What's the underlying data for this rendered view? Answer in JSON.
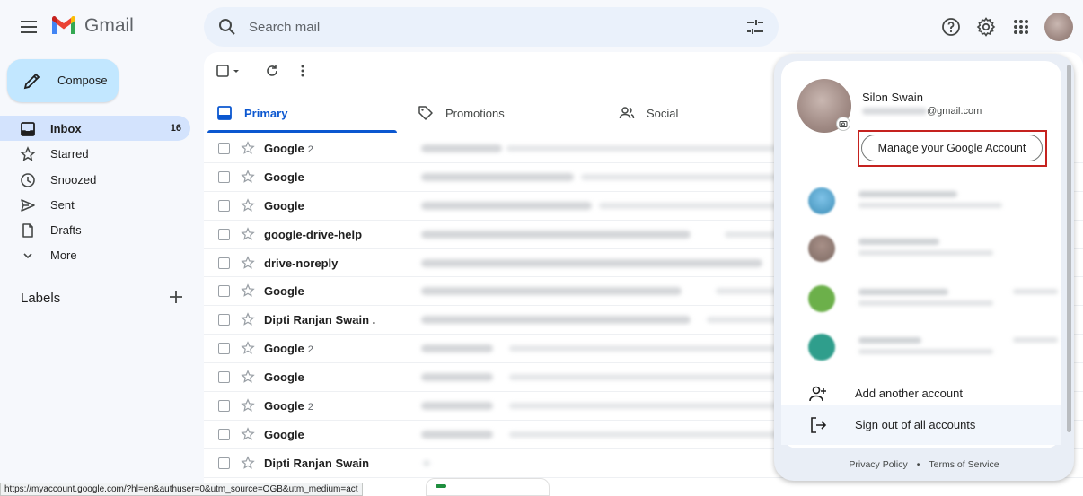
{
  "app": {
    "name": "Gmail"
  },
  "search": {
    "placeholder": "Search mail"
  },
  "compose": {
    "label": "Compose"
  },
  "sidebar": {
    "items": [
      {
        "label": "Inbox",
        "count": "16",
        "icon": "inbox-icon",
        "active": true
      },
      {
        "label": "Starred",
        "count": "",
        "icon": "star-icon"
      },
      {
        "label": "Snoozed",
        "count": "",
        "icon": "clock-icon"
      },
      {
        "label": "Sent",
        "count": "",
        "icon": "send-icon"
      },
      {
        "label": "Drafts",
        "count": "",
        "icon": "draft-icon"
      },
      {
        "label": "More",
        "count": "",
        "icon": "chevron-down-icon"
      }
    ],
    "labels_heading": "Labels"
  },
  "tabs": [
    {
      "label": "Primary",
      "icon": "inbox-icon",
      "active": true
    },
    {
      "label": "Promotions",
      "icon": "tag-icon"
    },
    {
      "label": "Social",
      "icon": "people-icon"
    }
  ],
  "emails": [
    {
      "sender": "Google",
      "count": "2"
    },
    {
      "sender": "Google",
      "count": ""
    },
    {
      "sender": "Google",
      "count": ""
    },
    {
      "sender": "google-drive-help",
      "count": ""
    },
    {
      "sender": "drive-noreply",
      "count": ""
    },
    {
      "sender": "Google",
      "count": ""
    },
    {
      "sender": "Dipti Ranjan Swain .",
      "count": ""
    },
    {
      "sender": "Google",
      "count": "2"
    },
    {
      "sender": "Google",
      "count": ""
    },
    {
      "sender": "Google",
      "count": "2"
    },
    {
      "sender": "Google",
      "count": ""
    },
    {
      "sender": "Dipti Ranjan Swain",
      "count": ""
    }
  ],
  "account_popup": {
    "name": "Silon Swain",
    "email_suffix": "@gmail.com",
    "manage_button": "Manage your Google Account",
    "add_account": "Add another account",
    "sign_out": "Sign out of all accounts",
    "privacy": "Privacy Policy",
    "separator": "•",
    "terms": "Terms of Service",
    "highlight_color": "#c5221f"
  },
  "status_bar": {
    "url": "https://myaccount.google.com/?hl=en&authuser=0&utm_source=OGB&utm_medium=act"
  },
  "colors": {
    "accent": "#0b57d0",
    "compose_bg": "#c2e7ff",
    "active_nav": "#d3e3fd"
  }
}
